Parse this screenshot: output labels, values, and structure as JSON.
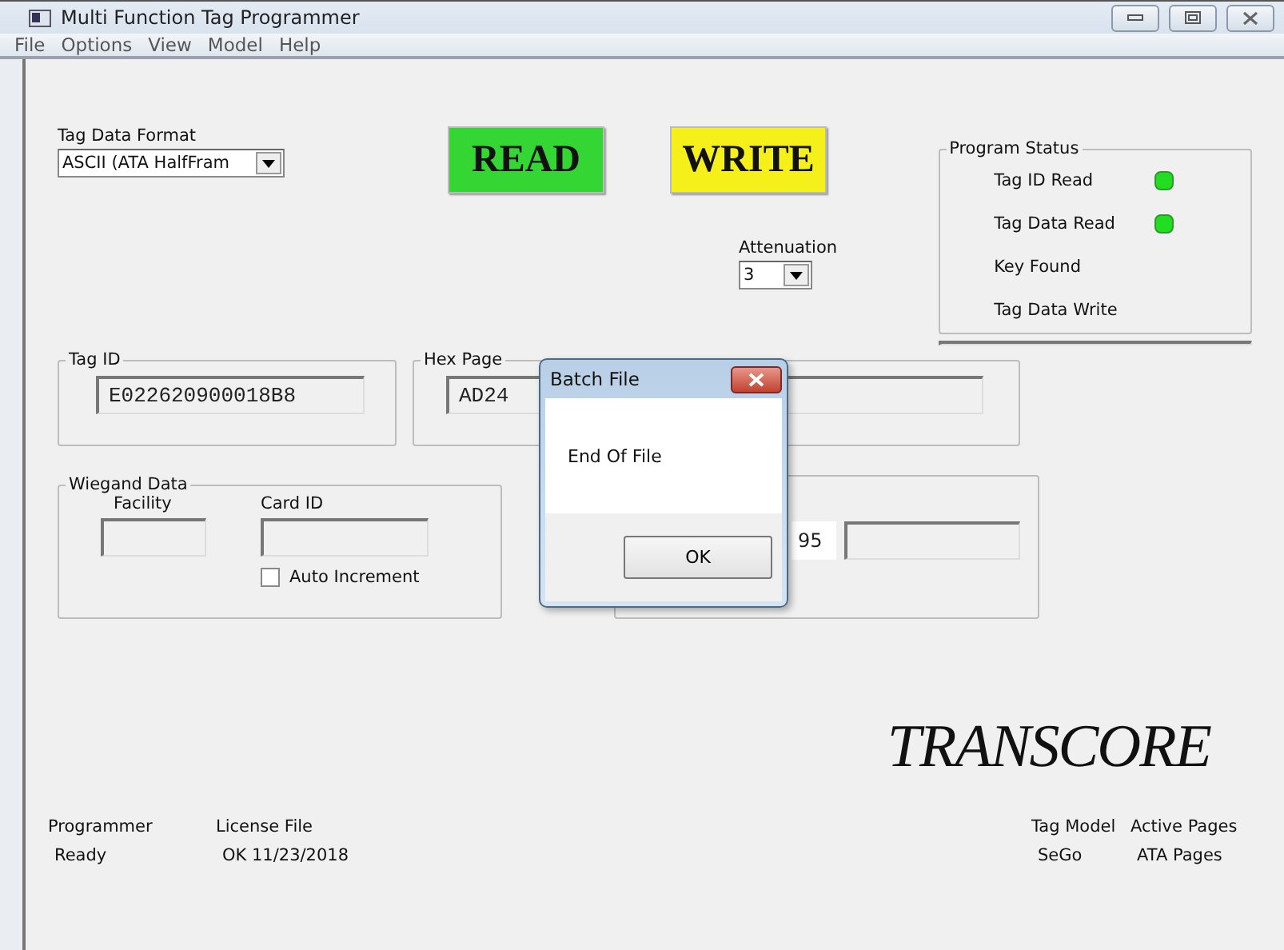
{
  "window": {
    "title": "Multi Function Tag Programmer"
  },
  "menu": [
    "File",
    "Options",
    "View",
    "Model",
    "Help"
  ],
  "tag_data_format": {
    "label": "Tag Data Format",
    "value": "ASCII (ATA HalfFram"
  },
  "read_button": "READ",
  "write_button": "WRITE",
  "attenuation": {
    "label": "Attenuation",
    "value": "3"
  },
  "program_status": {
    "title": "Program Status",
    "items": [
      {
        "label": "Tag ID Read",
        "on": true
      },
      {
        "label": "Tag Data Read",
        "on": true
      },
      {
        "label": "Key Found",
        "on": false
      },
      {
        "label": "Tag Data Write",
        "on": false
      }
    ]
  },
  "tag_id": {
    "title": "Tag ID",
    "value": "E022620900018B8"
  },
  "hex_page": {
    "title": "Hex Page",
    "value": "AD24"
  },
  "wiegand": {
    "title": "Wiegand Data",
    "facility_label": "Facility",
    "card_id_label": "Card ID",
    "auto_increment": {
      "label": "Auto Increment",
      "checked": false
    }
  },
  "right_group": {
    "field_value": "95"
  },
  "dialog": {
    "title": "Batch File",
    "message": "End Of File",
    "button": "OK"
  },
  "logo": "TRANSCORE",
  "status_bar": [
    {
      "label": "Programmer",
      "value": "Ready"
    },
    {
      "label": "License File",
      "value": "OK 11/23/2018"
    },
    {
      "label": "Tag Model",
      "value": "SeGo"
    },
    {
      "label": "Active Pages",
      "value": "ATA Pages"
    }
  ]
}
